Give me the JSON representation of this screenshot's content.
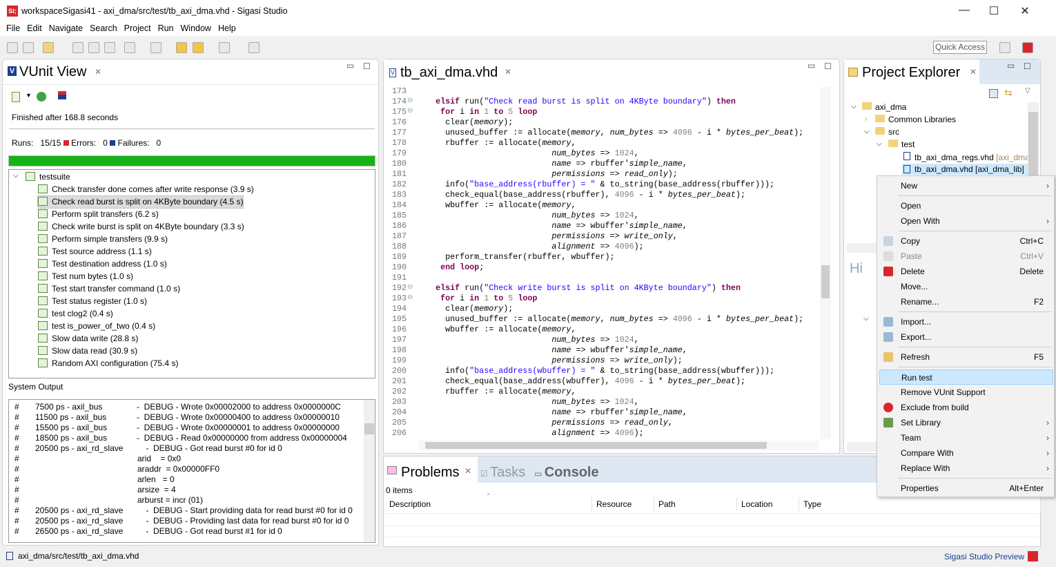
{
  "window": {
    "title": "workspaceSigasi41 - axi_dma/src/test/tb_axi_dma.vhd - Sigasi Studio",
    "logo": "SI;",
    "minimize": "—",
    "maximize": "☐",
    "close": "✕"
  },
  "menu": [
    "File",
    "Edit",
    "Navigate",
    "Search",
    "Project",
    "Run",
    "Window",
    "Help"
  ],
  "toolbar": {
    "quick_access": "Quick Access"
  },
  "vunit": {
    "title": "VUnit View",
    "status": "Finished after 168.8 seconds",
    "runs_label": "Runs:",
    "runs": "15/15",
    "errors_label": "Errors:",
    "errors": "0",
    "failures_label": "Failures:",
    "failures": "0",
    "progress": 1.0,
    "progress_color": "#16b316",
    "suite": "testsuite",
    "tests": [
      "Check transfer done comes after write response (3.9 s)",
      "Check read burst is split on 4KByte boundary (4.5 s)",
      "Perform split transfers (6.2 s)",
      "Check write burst is split on 4KByte boundary (3.3 s)",
      "Perform simple transfers (9.9 s)",
      "Test source address (1.1 s)",
      "Test destination address (1.0 s)",
      "Test num bytes (1.0 s)",
      "Test start transfer command (1.0 s)",
      "Test status register (1.0 s)",
      "test clog2 (0.4 s)",
      "test is_power_of_two (0.4 s)",
      "Slow data write (28.8 s)",
      "Slow data read (30.9 s)",
      "Random AXI configuration (75.4 s)"
    ],
    "selected_test": 1,
    "system_output_label": "System Output",
    "output": [
      [
        "#",
        "7500 ps - axil_bus",
        "-  DEBUG - Wrote 0x00002000 to address 0x0000000C"
      ],
      [
        "#",
        "11500 ps - axil_bus",
        "-  DEBUG - Wrote 0x00000400 to address 0x00000010"
      ],
      [
        "#",
        "15500 ps - axil_bus",
        "-  DEBUG - Wrote 0x00000001 to address 0x00000000"
      ],
      [
        "#",
        "18500 ps - axil_bus",
        "-  DEBUG - Read 0x00000000 from address 0x00000004"
      ],
      [
        "#",
        "20500 ps - axi_rd_slave",
        "    -  DEBUG - Got read burst #0 for id 0"
      ],
      [
        "#",
        "",
        "arid    = 0x0"
      ],
      [
        "#",
        "",
        "araddr  = 0x00000FF0"
      ],
      [
        "#",
        "",
        "arlen   = 0"
      ],
      [
        "#",
        "",
        "arsize  = 4"
      ],
      [
        "#",
        "",
        "arburst = incr (01)"
      ],
      [
        "#",
        "20500 ps - axi_rd_slave",
        "    -  DEBUG - Start providing data for read burst #0 for id 0"
      ],
      [
        "#",
        "20500 ps - axi_rd_slave",
        "    -  DEBUG - Providing last data for read burst #0 for id 0"
      ],
      [
        "#",
        "26500 ps - axi_rd_slave",
        "    -  DEBUG - Got read burst #1 for id 0"
      ]
    ]
  },
  "editor": {
    "tab": "tb_axi_dma.vhd",
    "first_line": 173,
    "folds": [
      174,
      175,
      192,
      193
    ],
    "lines": [
      [],
      [
        "    ",
        [
          "k",
          "elsif"
        ],
        " run(",
        [
          "s",
          "\"Check read burst is split on 4KByte boundary\""
        ],
        ") ",
        [
          "k",
          "then"
        ]
      ],
      [
        "     ",
        [
          "k",
          "for"
        ],
        " i ",
        [
          "k",
          "in"
        ],
        " ",
        [
          "n",
          "1"
        ],
        " ",
        [
          "k",
          "to"
        ],
        " ",
        [
          "n",
          "5"
        ],
        " ",
        [
          "k",
          "loop"
        ]
      ],
      [
        "      clear(",
        [
          "i",
          "memory"
        ],
        ");"
      ],
      [
        "      unused_buffer := allocate(",
        [
          "i",
          "memory"
        ],
        ", ",
        [
          "i",
          "num_bytes"
        ],
        " => ",
        [
          "n",
          "4096"
        ],
        " - i * ",
        [
          "i",
          "bytes_per_beat"
        ],
        ");"
      ],
      [
        "      rbuffer := allocate(",
        [
          "i",
          "memory"
        ],
        ","
      ],
      [
        "                            ",
        [
          "i",
          "num_bytes"
        ],
        " => ",
        [
          "n",
          "1024"
        ],
        ","
      ],
      [
        "                            ",
        [
          "i",
          "name"
        ],
        " => rbuffer'",
        [
          "i",
          "simple_name"
        ],
        ","
      ],
      [
        "                            ",
        [
          "i",
          "permissions"
        ],
        " => ",
        [
          "i",
          "read_only"
        ],
        ");"
      ],
      [
        "      info(",
        [
          "s",
          "\"base_address(rbuffer) = \""
        ],
        " & to_string(base_address(rbuffer)));"
      ],
      [
        "      check_equal(base_address(rbuffer), ",
        [
          "n",
          "4096"
        ],
        " - i * ",
        [
          "i",
          "bytes_per_beat"
        ],
        ");"
      ],
      [
        "      wbuffer := allocate(",
        [
          "i",
          "memory"
        ],
        ","
      ],
      [
        "                            ",
        [
          "i",
          "num_bytes"
        ],
        " => ",
        [
          "n",
          "1024"
        ],
        ","
      ],
      [
        "                            ",
        [
          "i",
          "name"
        ],
        " => wbuffer'",
        [
          "i",
          "simple_name"
        ],
        ","
      ],
      [
        "                            ",
        [
          "i",
          "permissions"
        ],
        " => ",
        [
          "i",
          "write_only"
        ],
        ","
      ],
      [
        "                            ",
        [
          "i",
          "alignment"
        ],
        " => ",
        [
          "n",
          "4096"
        ],
        ");"
      ],
      [
        "      perform_transfer(rbuffer, wbuffer);"
      ],
      [
        "     ",
        [
          "k",
          "end"
        ],
        " ",
        [
          "k",
          "loop"
        ],
        ";"
      ],
      [],
      [
        "    ",
        [
          "k",
          "elsif"
        ],
        " run(",
        [
          "s",
          "\"Check write burst is split on 4KByte boundary\""
        ],
        ") ",
        [
          "k",
          "then"
        ]
      ],
      [
        "     ",
        [
          "k",
          "for"
        ],
        " i ",
        [
          "k",
          "in"
        ],
        " ",
        [
          "n",
          "1"
        ],
        " ",
        [
          "k",
          "to"
        ],
        " ",
        [
          "n",
          "5"
        ],
        " ",
        [
          "k",
          "loop"
        ]
      ],
      [
        "      clear(",
        [
          "i",
          "memory"
        ],
        ");"
      ],
      [
        "      unused_buffer := allocate(",
        [
          "i",
          "memory"
        ],
        ", ",
        [
          "i",
          "num_bytes"
        ],
        " => ",
        [
          "n",
          "4096"
        ],
        " - i * ",
        [
          "i",
          "bytes_per_beat"
        ],
        ");"
      ],
      [
        "      wbuffer := allocate(",
        [
          "i",
          "memory"
        ],
        ","
      ],
      [
        "                            ",
        [
          "i",
          "num_bytes"
        ],
        " => ",
        [
          "n",
          "1024"
        ],
        ","
      ],
      [
        "                            ",
        [
          "i",
          "name"
        ],
        " => wbuffer'",
        [
          "i",
          "simple_name"
        ],
        ","
      ],
      [
        "                            ",
        [
          "i",
          "permissions"
        ],
        " => ",
        [
          "i",
          "write_only"
        ],
        ");"
      ],
      [
        "      info(",
        [
          "s",
          "\"base_address(wbuffer) = \""
        ],
        " & to_string(base_address(wbuffer)));"
      ],
      [
        "      check_equal(base_address(wbuffer), ",
        [
          "n",
          "4096"
        ],
        " - i * ",
        [
          "i",
          "bytes_per_beat"
        ],
        ");"
      ],
      [
        "      rbuffer := allocate(",
        [
          "i",
          "memory"
        ],
        ","
      ],
      [
        "                            ",
        [
          "i",
          "num_bytes"
        ],
        " => ",
        [
          "n",
          "1024"
        ],
        ","
      ],
      [
        "                            ",
        [
          "i",
          "name"
        ],
        " => rbuffer'",
        [
          "i",
          "simple_name"
        ],
        ","
      ],
      [
        "                            ",
        [
          "i",
          "permissions"
        ],
        " => ",
        [
          "i",
          "read_only"
        ],
        ","
      ],
      [
        "                            ",
        [
          "i",
          "alignment"
        ],
        " => ",
        [
          "n",
          "4096"
        ],
        ");"
      ]
    ]
  },
  "explorer": {
    "title": "Project Explorer",
    "project": "axi_dma",
    "common": "Common Libraries",
    "src": "src",
    "test": "test",
    "file1": "tb_axi_dma_regs.vhd",
    "file1_lib": "[axi_dma_",
    "file2": "tb_axi_dma.vhd [axi_dma_lib]",
    "hier_title": "Hi"
  },
  "context_menu": [
    {
      "label": "New",
      "submenu": true
    },
    {
      "sep": true
    },
    {
      "label": "Open"
    },
    {
      "label": "Open With",
      "submenu": true
    },
    {
      "sep": true
    },
    {
      "label": "Copy",
      "shortcut": "Ctrl+C",
      "icon": "copy"
    },
    {
      "label": "Paste",
      "shortcut": "Ctrl+V",
      "icon": "paste",
      "disabled": true
    },
    {
      "label": "Delete",
      "shortcut": "Delete",
      "icon": "delete"
    },
    {
      "label": "Move..."
    },
    {
      "label": "Rename...",
      "shortcut": "F2"
    },
    {
      "sep": true
    },
    {
      "label": "Import...",
      "icon": "import"
    },
    {
      "label": "Export...",
      "icon": "export"
    },
    {
      "sep": true
    },
    {
      "label": "Refresh",
      "shortcut": "F5",
      "icon": "refresh"
    },
    {
      "sep": true
    },
    {
      "label": "Run test",
      "highlighted": true
    },
    {
      "label": "Remove VUnit Support"
    },
    {
      "label": "Exclude from build",
      "icon": "exclude"
    },
    {
      "label": "Set Library",
      "submenu": true,
      "icon": "library"
    },
    {
      "label": "Team",
      "submenu": true
    },
    {
      "label": "Compare With",
      "submenu": true
    },
    {
      "label": "Replace With",
      "submenu": true
    },
    {
      "sep": true
    },
    {
      "label": "Properties",
      "shortcut": "Alt+Enter"
    }
  ],
  "bottom": {
    "tabs": [
      "Problems",
      "Tasks",
      "Console"
    ],
    "count": "0 items",
    "columns": [
      "Description",
      "Resource",
      "Path",
      "Location",
      "Type"
    ]
  },
  "statusbar": {
    "path": "axi_dma/src/test/tb_axi_dma.vhd",
    "preview": "Sigasi Studio Preview"
  }
}
